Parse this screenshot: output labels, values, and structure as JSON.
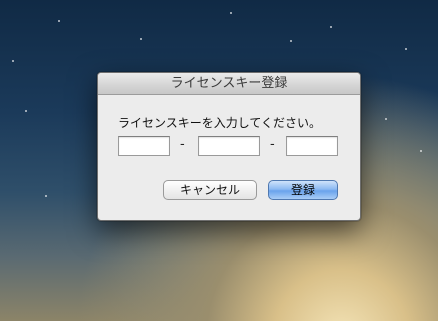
{
  "dialog": {
    "title": "ライセンスキー登録",
    "message": "ライセンスキーを入力してください。",
    "fields": [
      {
        "value": "",
        "placeholder": ""
      },
      {
        "value": "",
        "placeholder": ""
      },
      {
        "value": "",
        "placeholder": ""
      }
    ],
    "separator": "-",
    "cancel_label": "キャンセル",
    "ok_label": "登録"
  },
  "colors": {
    "default_button": "#6aa3ec",
    "window_bg": "#ececec"
  }
}
